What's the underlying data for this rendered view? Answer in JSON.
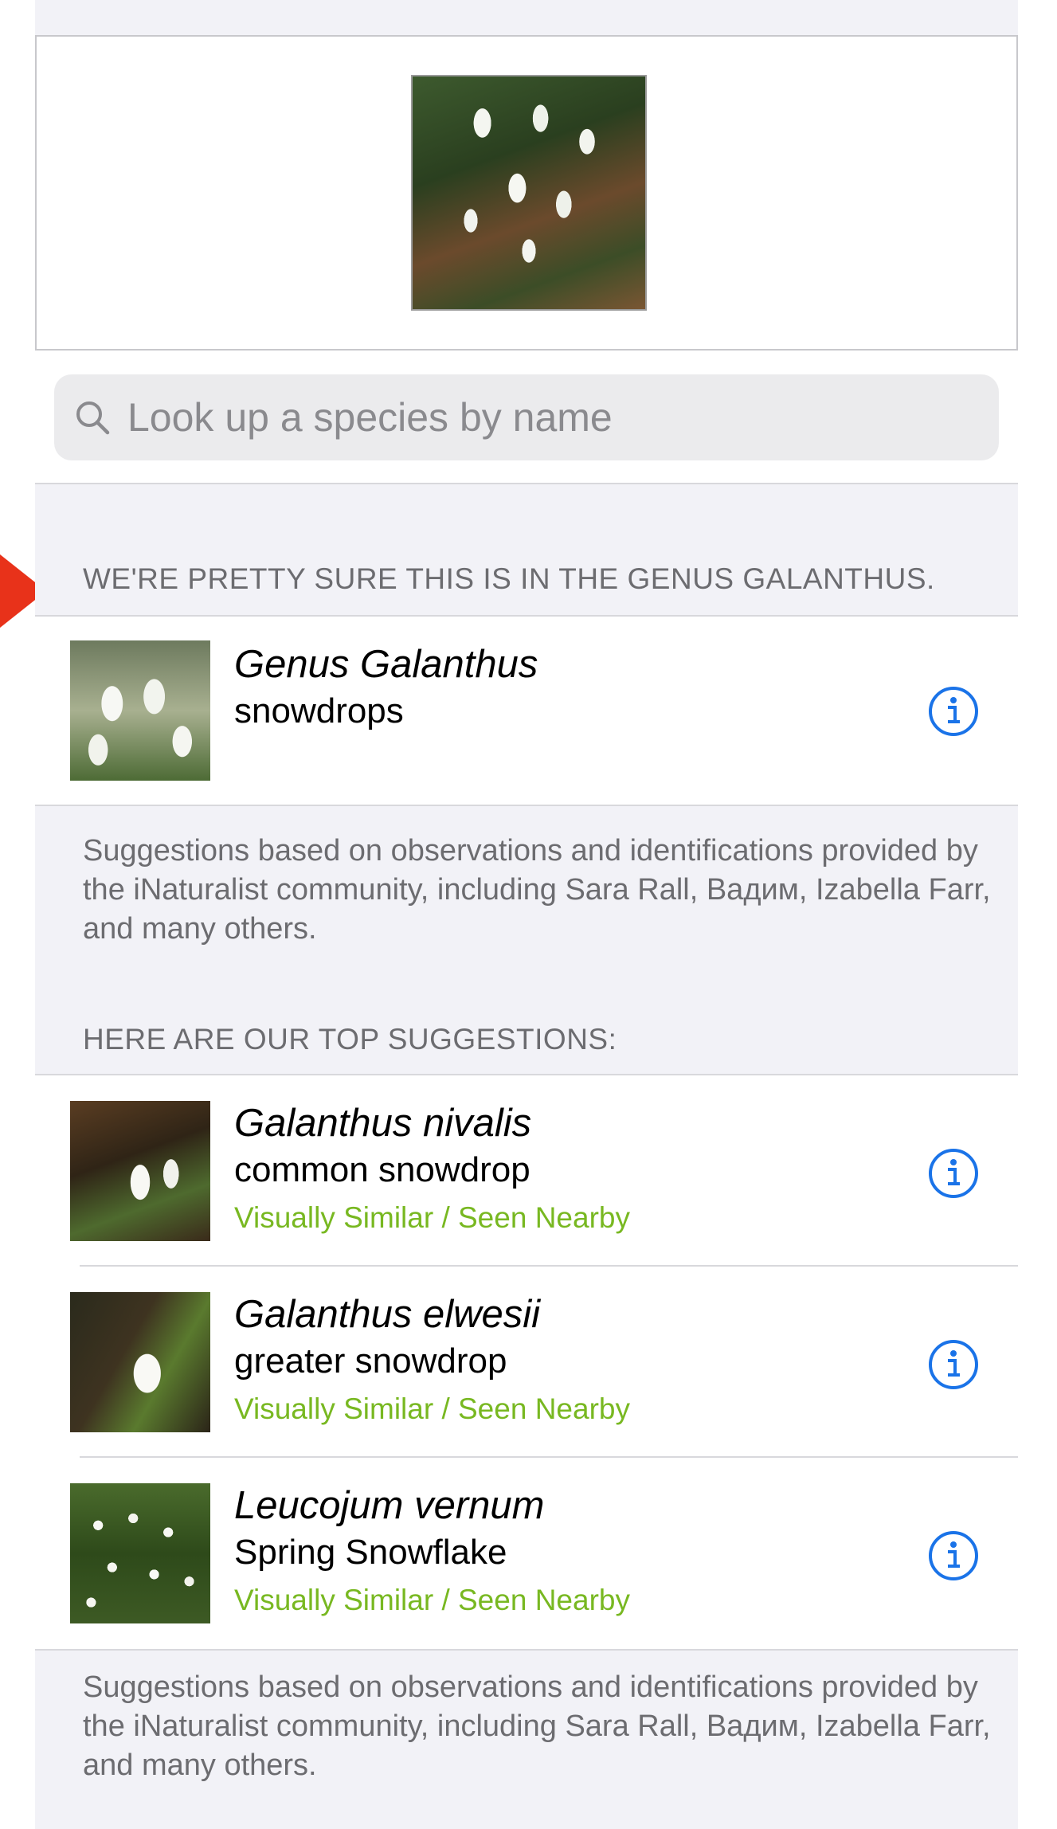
{
  "colors": {
    "accent": "#1a73e8",
    "tag_green": "#78b821",
    "section_text": "#6c6c70",
    "annotation_arrow": "#e8321a"
  },
  "photo": {
    "icon": "observation-photo"
  },
  "search": {
    "placeholder": "Look up a species by name"
  },
  "genus_section": {
    "header": "WE'RE PRETTY SURE THIS IS IN THE GENUS GALANTHUS.",
    "item": {
      "title": "Genus Galanthus",
      "subtitle": "snowdrops"
    }
  },
  "credits_1": "Suggestions based on observations and identifications provided by the iNaturalist community, including Sara Rall, Вадим, Izabella Farr, and many others.",
  "top_section": {
    "header": "HERE ARE OUR TOP SUGGESTIONS:",
    "items": [
      {
        "title": "Galanthus nivalis",
        "subtitle": "common snowdrop",
        "tag": "Visually Similar / Seen Nearby"
      },
      {
        "title": "Galanthus elwesii",
        "subtitle": "greater snowdrop",
        "tag": "Visually Similar / Seen Nearby"
      },
      {
        "title": "Leucojum vernum",
        "subtitle": "Spring Snowflake",
        "tag": "Visually Similar / Seen Nearby"
      }
    ]
  },
  "credits_2": "Suggestions based on observations and identifications provided by the iNaturalist community, including Sara Rall, Вадим, Izabella Farr, and many others."
}
